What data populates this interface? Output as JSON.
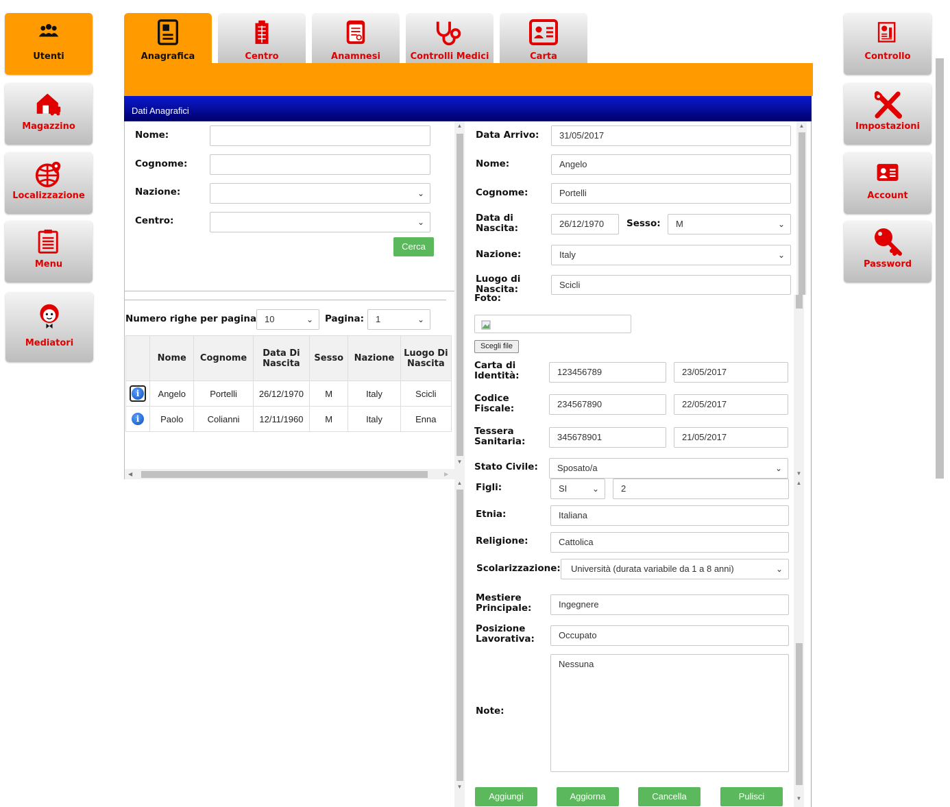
{
  "left_nav": [
    {
      "label": "Utenti",
      "icon": "users-icon"
    },
    {
      "label": "Magazzino",
      "icon": "warehouse-icon"
    },
    {
      "label": "Localizzazione",
      "icon": "globe-location-icon"
    },
    {
      "label": "Menu",
      "icon": "clipboard-icon"
    },
    {
      "label": "Mediatori",
      "icon": "mediator-icon"
    }
  ],
  "right_nav": [
    {
      "label": "Controllo",
      "icon": "report-icon"
    },
    {
      "label": "Impostazioni",
      "icon": "tools-icon"
    },
    {
      "label": "Account",
      "icon": "id-card-icon"
    },
    {
      "label": "Password",
      "icon": "key-icon"
    }
  ],
  "tabs": [
    {
      "label": "Anagrafica",
      "icon": "document-icon"
    },
    {
      "label": "Centro",
      "icon": "building-icon"
    },
    {
      "label": "Anamnesi",
      "icon": "medical-record-icon"
    },
    {
      "label": "Controlli Medici",
      "icon": "stethoscope-icon"
    },
    {
      "label": "Carta",
      "icon": "id-card-icon"
    }
  ],
  "section_title": "Dati Anagrafici",
  "search": {
    "nome_label": "Nome:",
    "cognome_label": "Cognome:",
    "nazione_label": "Nazione:",
    "centro_label": "Centro:",
    "cerca_button": "Cerca",
    "rows_label": "Numero righe per pagina:",
    "rows_value": "10",
    "page_label": "Pagina:",
    "page_value": "1"
  },
  "table": {
    "headers": [
      "",
      "Nome",
      "Cognome",
      "Data Di Nascita",
      "Sesso",
      "Nazione",
      "Luogo Di Nascita"
    ],
    "rows": [
      [
        "Angelo",
        "Portelli",
        "26/12/1970",
        "M",
        "Italy",
        "Scicli"
      ],
      [
        "Paolo",
        "Colianni",
        "12/11/1960",
        "M",
        "Italy",
        "Enna"
      ]
    ]
  },
  "form": {
    "data_arrivo_label": "Data Arrivo:",
    "data_arrivo": "31/05/2017",
    "nome_label": "Nome:",
    "nome": "Angelo",
    "cognome_label": "Cognome:",
    "cognome": "Portelli",
    "data_nascita_label": "Data di Nascita:",
    "data_nascita": "26/12/1970",
    "sesso_label": "Sesso:",
    "sesso": "M",
    "nazione_label": "Nazione:",
    "nazione": "Italy",
    "luogo_label": "Luogo di Nascita:",
    "luogo": "Scicli",
    "foto_label": "Foto:",
    "file_button": "Scegli file",
    "carta_label": "Carta di Identità:",
    "carta_num": "123456789",
    "carta_date": "23/05/2017",
    "codice_label": "Codice Fiscale:",
    "codice_num": "234567890",
    "codice_date": "22/05/2017",
    "tessera_label": "Tessera Sanitaria:",
    "tessera_num": "345678901",
    "tessera_date": "21/05/2017",
    "stato_label": "Stato Civile:",
    "stato": "Sposato/a",
    "figli_label": "Figli:",
    "figli": "SI",
    "figli_num": "2",
    "etnia_label": "Etnia:",
    "etnia": "Italiana",
    "religione_label": "Religione:",
    "religione": "Cattolica",
    "scolar_label": "Scolarizzazione:",
    "scolar": "Università (durata variabile da 1 a 8 anni)",
    "mestiere_label": "Mestiere Principale:",
    "mestiere": "Ingegnere",
    "posizione_label": "Posizione Lavorativa:",
    "posizione": "Occupato",
    "note_label": "Note:",
    "note": "Nessuna",
    "buttons": [
      "Aggiungi",
      "Aggiorna",
      "Cancella",
      "Pulisci"
    ]
  }
}
